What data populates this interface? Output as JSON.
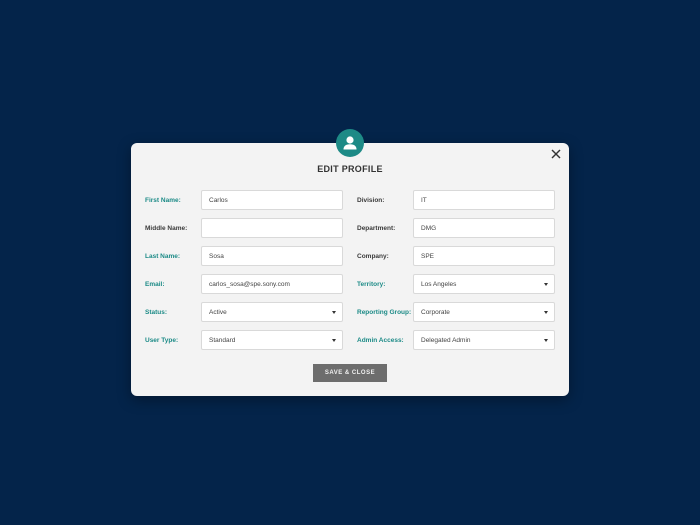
{
  "dialog": {
    "title": "EDIT PROFILE",
    "save_label": "SAVE & CLOSE"
  },
  "left_fields": [
    {
      "label": "First Name:",
      "value": "Carlos",
      "type": "text",
      "color": "#1b8a86"
    },
    {
      "label": "Middle Name:",
      "value": "",
      "type": "text",
      "color": "#3a3a3a"
    },
    {
      "label": "Last Name:",
      "value": "Sosa",
      "type": "text",
      "color": "#1b8a86"
    },
    {
      "label": "Email:",
      "value": "carlos_sosa@spe.sony.com",
      "type": "text",
      "color": "#1b8a86"
    },
    {
      "label": "Status:",
      "value": "Active",
      "type": "select",
      "color": "#1b8a86"
    },
    {
      "label": "User Type:",
      "value": "Standard",
      "type": "select",
      "color": "#1b8a86"
    }
  ],
  "right_fields": [
    {
      "label": "Division:",
      "value": "IT",
      "type": "text",
      "color": "#3a3a3a"
    },
    {
      "label": "Department:",
      "value": "DMG",
      "type": "text",
      "color": "#3a3a3a"
    },
    {
      "label": "Company:",
      "value": "SPE",
      "type": "text",
      "color": "#3a3a3a"
    },
    {
      "label": "Territory:",
      "value": "Los Angeles",
      "type": "select",
      "color": "#1b8a86"
    },
    {
      "label": "Reporting Group:",
      "value": "Corporate",
      "type": "select",
      "color": "#1b8a86"
    },
    {
      "label": "Admin Access:",
      "value": "Delegated Admin",
      "type": "select",
      "color": "#1b8a86"
    }
  ],
  "colors": {
    "background": "#04244a",
    "accent": "#1b8a86",
    "button": "#6d6d6d"
  },
  "icons": {
    "avatar": "user-avatar-icon",
    "close": "close-icon",
    "dropdown": "caret-down-icon"
  }
}
